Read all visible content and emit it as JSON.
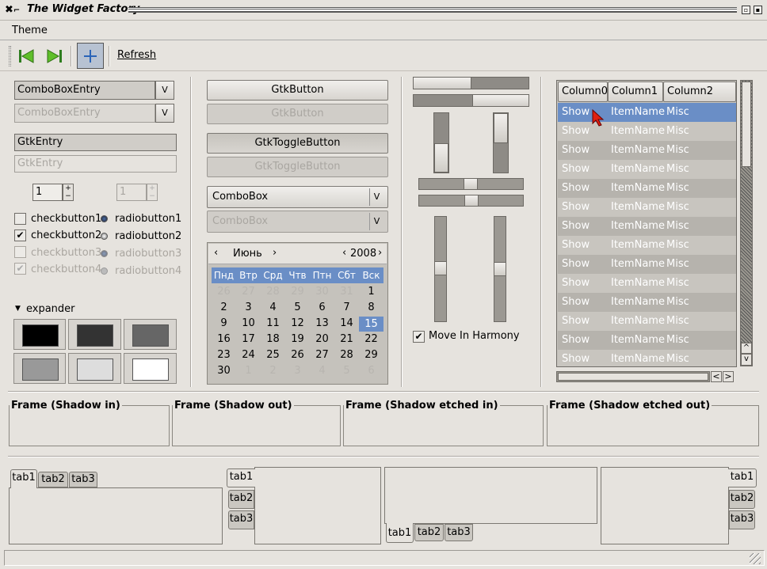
{
  "window": {
    "title": "The Widget Factory"
  },
  "menu": {
    "theme": "Theme"
  },
  "toolbar": {
    "refresh": "Refresh"
  },
  "left": {
    "combo_entry": "ComboBoxEntry",
    "combo_entry_dis": "ComboBoxEntry",
    "entry": "GtkEntry",
    "entry_dis": "GtkEntry",
    "spin1": "1",
    "spin2": "1",
    "checks": [
      "checkbutton1",
      "checkbutton2",
      "checkbutton3",
      "checkbutton4"
    ],
    "radios": [
      "radiobutton1",
      "radiobutton2",
      "radiobutton3",
      "radiobutton4"
    ],
    "expander": "expander"
  },
  "middle": {
    "button": "GtkButton",
    "button_dis": "GtkButton",
    "toggle": "GtkToggleButton",
    "toggle_dis": "GtkToggleButton",
    "combo": "ComboBox",
    "combo_dis": "ComboBox",
    "calendar": {
      "month": "Июнь",
      "year": "2008",
      "weekdays": [
        "Пнд",
        "Втр",
        "Срд",
        "Чтв",
        "Птн",
        "Сбт",
        "Вск"
      ],
      "days": [
        [
          "26",
          "27",
          "28",
          "29",
          "30",
          "31",
          "1"
        ],
        [
          "2",
          "3",
          "4",
          "5",
          "6",
          "7",
          "8"
        ],
        [
          "9",
          "10",
          "11",
          "12",
          "13",
          "14",
          "15"
        ],
        [
          "16",
          "17",
          "18",
          "19",
          "20",
          "21",
          "22"
        ],
        [
          "23",
          "24",
          "25",
          "26",
          "27",
          "28",
          "29"
        ],
        [
          "30",
          "1",
          "2",
          "3",
          "4",
          "5",
          "6"
        ]
      ],
      "selected": "15"
    }
  },
  "sliders": {
    "harmony": "Move In Harmony"
  },
  "tree": {
    "columns": [
      "Column0",
      "Column1",
      "Column2"
    ],
    "rows": [
      [
        "Show",
        "ItemName",
        "Misc"
      ],
      [
        "Show",
        "ItemName",
        "Misc"
      ],
      [
        "Show",
        "ItemName",
        "Misc"
      ],
      [
        "Show",
        "ItemName",
        "Misc"
      ],
      [
        "Show",
        "ItemName",
        "Misc"
      ],
      [
        "Show",
        "ItemName",
        "Misc"
      ],
      [
        "Show",
        "ItemName",
        "Misc"
      ],
      [
        "Show",
        "ItemName",
        "Misc"
      ],
      [
        "Show",
        "ItemName",
        "Misc"
      ],
      [
        "Show",
        "ItemName",
        "Misc"
      ],
      [
        "Show",
        "ItemName",
        "Misc"
      ],
      [
        "Show",
        "ItemName",
        "Misc"
      ],
      [
        "Show",
        "ItemName",
        "Misc"
      ],
      [
        "Show",
        "ItemName",
        "Misc"
      ]
    ]
  },
  "frames": [
    "Frame (Shadow in)",
    "Frame (Shadow out)",
    "Frame (Shadow etched in)",
    "Frame (Shadow etched out)"
  ],
  "tabs": [
    "tab1",
    "tab2",
    "tab3"
  ],
  "colors": {
    "selection": "#6a8ec6",
    "row_even": "#b6b3ad",
    "row_odd": "#c8c5bf"
  }
}
